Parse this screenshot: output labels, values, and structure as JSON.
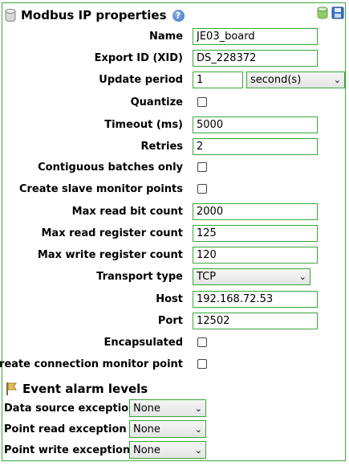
{
  "header": {
    "title": "Modbus IP properties",
    "help_icon": "?"
  },
  "fields": {
    "name": {
      "label": "Name",
      "value": "JE03_board"
    },
    "xid": {
      "label": "Export ID (XID)",
      "value": "DS_228372"
    },
    "update_period": {
      "label": "Update period",
      "value": "1",
      "unit": "second(s)"
    },
    "quantize": {
      "label": "Quantize"
    },
    "timeout": {
      "label": "Timeout (ms)",
      "value": "5000"
    },
    "retries": {
      "label": "Retries",
      "value": "2"
    },
    "contiguous": {
      "label": "Contiguous batches only"
    },
    "slave_monitor": {
      "label": "Create slave monitor points"
    },
    "max_read_bit": {
      "label": "Max read bit count",
      "value": "2000"
    },
    "max_read_register": {
      "label": "Max read register count",
      "value": "125"
    },
    "max_write_register": {
      "label": "Max write register count",
      "value": "120"
    },
    "transport": {
      "label": "Transport type",
      "value": "TCP"
    },
    "host": {
      "label": "Host",
      "value": "192.168.72.53"
    },
    "port": {
      "label": "Port",
      "value": "12502"
    },
    "encapsulated": {
      "label": "Encapsulated"
    },
    "connection_monitor": {
      "label": "Create connection monitor point"
    }
  },
  "alarms": {
    "title": "Event alarm levels",
    "items": [
      {
        "label": "Data source exception",
        "value": "None"
      },
      {
        "label": "Point read exception",
        "value": "None"
      },
      {
        "label": "Point write exception",
        "value": "None"
      }
    ]
  },
  "colors": {
    "border": "#39a839",
    "accent": "#3c6fc4"
  }
}
